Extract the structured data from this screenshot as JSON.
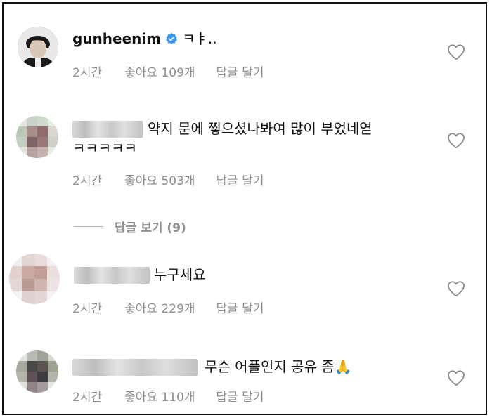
{
  "comments": [
    {
      "username": "gunheenim",
      "verified": true,
      "text": "ㅋㅑ..",
      "time": "2시간",
      "likes": "좋아요 109개",
      "reply": "답글 달기"
    },
    {
      "username": "",
      "text_line1": "약지 문에 찧으셨나봐여 많이 부었네엳",
      "text_line2": "ㅋㅋㅋㅋㅋ",
      "time": "2시간",
      "likes": "좋아요 503개",
      "reply": "답글 달기",
      "view_replies": "답글 보기 (9)"
    },
    {
      "username": "",
      "text": "누구세요",
      "time": "2시간",
      "likes": "좋아요 229개",
      "reply": "답글 달기"
    },
    {
      "username": "",
      "text": "무슨 어플인지 공유 좀🙏",
      "time": "2시간",
      "likes": "좋아요 110개",
      "reply": "답글 달기"
    }
  ],
  "colors": {
    "meta": "#8e8e8e",
    "verified": "#3897f0",
    "text": "#111111"
  },
  "icons": {
    "like": "heart-outline-icon",
    "verified": "verified-badge-icon"
  }
}
